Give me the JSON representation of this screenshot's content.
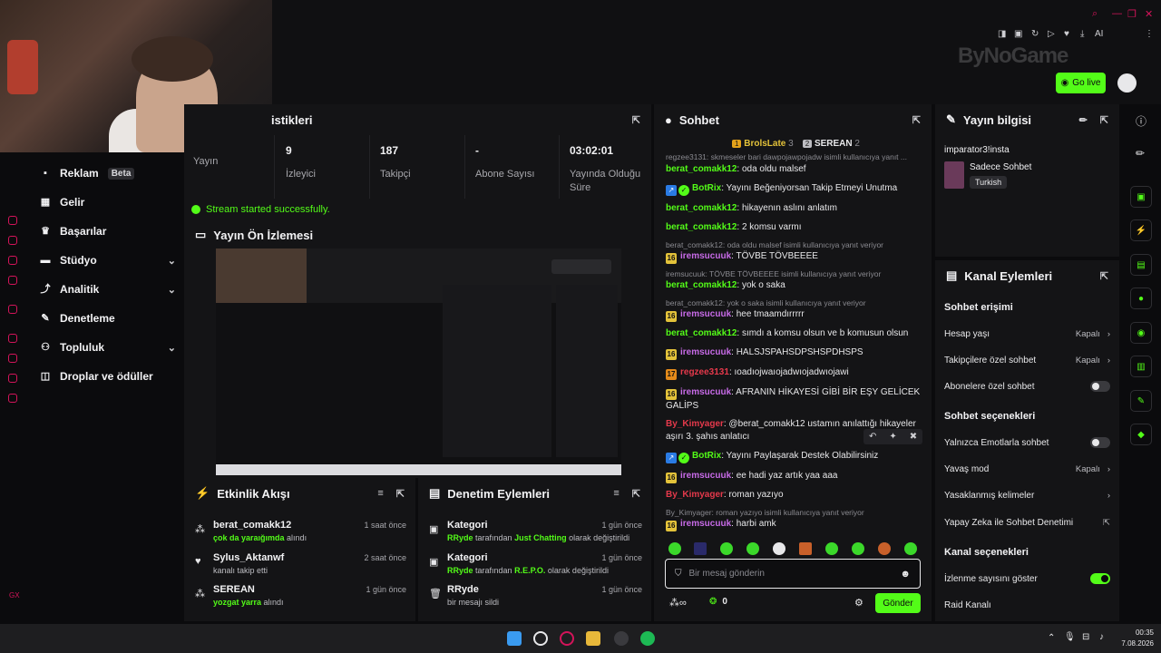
{
  "header": {
    "logo_text": "ByNoGame",
    "go_live_label": "Go live",
    "window_controls": [
      "search-icon",
      "minimize-icon",
      "maximize-icon",
      "close-icon"
    ],
    "extensions_label": "AI"
  },
  "sidebar": {
    "items": [
      {
        "label": "Reklam",
        "badge": "Beta",
        "icon": "megaphone-icon"
      },
      {
        "label": "Gelir",
        "icon": "chart-icon"
      },
      {
        "label": "Başarılar",
        "icon": "trophy-icon"
      },
      {
        "label": "Stüdyo",
        "icon": "studio-icon",
        "expandable": true
      },
      {
        "label": "Analitik",
        "icon": "analytics-icon",
        "expandable": true
      },
      {
        "label": "Denetleme",
        "icon": "wrench-icon"
      },
      {
        "label": "Topluluk",
        "icon": "people-icon",
        "expandable": true
      },
      {
        "label": "Droplar ve ödüller",
        "icon": "gift-icon"
      }
    ],
    "footer": "GX"
  },
  "stats": {
    "title": "istikleri",
    "items": [
      {
        "value": "",
        "label": "Yayın"
      },
      {
        "value": "9",
        "label": "İzleyici"
      },
      {
        "value": "187",
        "label": "Takipçi"
      },
      {
        "value": "-",
        "label": "Abone Sayısı"
      },
      {
        "value": "03:02:01",
        "label": "Yayında Olduğu Süre"
      }
    ],
    "status": "Stream started successfully."
  },
  "preview": {
    "title": "Yayın Ön İzlemesi"
  },
  "activity": {
    "title": "Etkinlik Akışı",
    "items": [
      {
        "user": "berat_comakk12",
        "time": "1 saat önce",
        "detail_hl": "çok da yaraığımda",
        "detail": " alındı",
        "icon": "reward-icon"
      },
      {
        "user": "Sylus_Aktanwf",
        "time": "2 saat önce",
        "detail_hl": "",
        "detail": "kanalı takip etti",
        "icon": "heart-icon"
      },
      {
        "user": "SEREAN",
        "time": "1 gün önce",
        "detail_hl": "yozgat yarra",
        "detail": " alındı",
        "icon": "reward-icon"
      }
    ]
  },
  "mod_actions": {
    "title": "Denetim Eylemleri",
    "items": [
      {
        "title": "Kategori",
        "time": "1 gün önce",
        "by": "RRyde",
        "mid": " tarafından ",
        "hl": "Just Chatting",
        "tail": " olarak değiştirildi",
        "icon": "category-icon"
      },
      {
        "title": "Kategori",
        "time": "1 gün önce",
        "by": "RRyde",
        "mid": " tarafından ",
        "hl": "R.E.P.O.",
        "tail": " olarak değiştirildi",
        "icon": "category-icon"
      },
      {
        "title": "RRyde",
        "time": "1 gün önce",
        "by": "",
        "mid": "",
        "hl": "",
        "tail": "bir mesajı sildi",
        "icon": "trash-icon"
      }
    ]
  },
  "chat": {
    "title": "Sohbet",
    "top_gifters": [
      {
        "name": "BrolsLate",
        "count": "3",
        "rank": "1"
      },
      {
        "name": "SEREAN",
        "count": "2",
        "rank": "2"
      }
    ],
    "messages": [
      {
        "kind": "reply",
        "text": "regzee3131: skmeseler bari dawpojawpojadw isimli kullanıcıya yanıt ..."
      },
      {
        "kind": "msg",
        "user": "berat_comakk12",
        "color": "#53fc18",
        "text": ": oda oldu malsef"
      },
      {
        "kind": "msg",
        "user": "BotRix",
        "color": "#53fc18",
        "bot": true,
        "text": ": Yayını Beğeniyorsan Takip Etmeyi Unutma"
      },
      {
        "kind": "msg",
        "user": "berat_comakk12",
        "color": "#53fc18",
        "text": ": hikayenın aslını anlatım"
      },
      {
        "kind": "msg",
        "user": "berat_comakk12",
        "color": "#53fc18",
        "text": ": 2 komsu varmı"
      },
      {
        "kind": "reply",
        "text": "berat_comakk12: oda oldu malsef isimli kullanıcıya yanıt veriyor"
      },
      {
        "kind": "msg",
        "user": "iremsucuuk",
        "color": "#c86be8",
        "sub": "16",
        "text": ": TÖVBE TÖVBEEEE"
      },
      {
        "kind": "reply",
        "text": "iremsucuuk: TÖVBE TÖVBEEEE isimli kullanıcıya yanıt veriyor"
      },
      {
        "kind": "msg",
        "user": "berat_comakk12",
        "color": "#53fc18",
        "text": ": yok o saka"
      },
      {
        "kind": "reply",
        "text": "berat_comakk12: yok o saka isimli kullanıcıya yanıt veriyor"
      },
      {
        "kind": "msg",
        "user": "iremsucuuk",
        "color": "#c86be8",
        "sub": "16",
        "text": ": hee tmaamdırrrrr"
      },
      {
        "kind": "msg",
        "user": "berat_comakk12",
        "color": "#53fc18",
        "text": ": sımdı a komsu olsun ve b komusun olsun"
      },
      {
        "kind": "msg",
        "user": "iremsucuuk",
        "color": "#c86be8",
        "sub": "16",
        "text": ": HALSJSPAHSDPSHSPDHSPS"
      },
      {
        "kind": "msg",
        "user": "regzee3131",
        "color": "#e5394b",
        "sub": "17",
        "text": ": ıoadıojwaıojadwıojadwıojawi"
      },
      {
        "kind": "msg",
        "user": "iremsucuuk",
        "color": "#c86be8",
        "sub": "16",
        "text": ": AFRANIN HİKAYESİ GİBİ BİR EŞY GELİCEK GALİPS"
      },
      {
        "kind": "msg",
        "user": "By_Kimyager",
        "color": "#e5394b",
        "text": ": @berat_comakk12 ustamın anılattığı hikayeler aşırı 3. şahıs anlatıcı"
      },
      {
        "kind": "msg",
        "user": "BotRix",
        "color": "#53fc18",
        "bot": true,
        "text": ": Yayını Paylaşarak Destek Olabilirsiniz"
      },
      {
        "kind": "msg",
        "user": "iremsucuuk",
        "color": "#c86be8",
        "sub": "16",
        "text": ": ee hadi yaz artık yaa aaa"
      },
      {
        "kind": "msg",
        "user": "By_Kimyager",
        "color": "#e5394b",
        "text": ": roman yazıyo"
      },
      {
        "kind": "reply",
        "text": "By_Kimyager: roman yazıyo isimli kullanıcıya yanıt veriyor"
      },
      {
        "kind": "msg",
        "user": "iremsucuuk",
        "color": "#c86be8",
        "sub": "16",
        "text": ": harbi amk"
      }
    ],
    "input_placeholder": "Bir mesaj gönderin",
    "points": "0",
    "send_label": "Gönder"
  },
  "stream_info": {
    "title": "Yayın bilgisi",
    "stream_title": "imparator3!insta",
    "category": "Sadece Sohbet",
    "tag": "Turkish"
  },
  "channel_actions": {
    "title": "Kanal Eylemleri",
    "chat_access_title": "Sohbet erişimi",
    "chat_options_title": "Sohbet seçenekleri",
    "channel_options_title": "Kanal seçenekleri",
    "off_label": "Kapalı",
    "rows": {
      "account_age": "Hesap yaşı",
      "followers_only": "Takipçilere özel sohbet",
      "subs_only": "Abonelere özel sohbet",
      "emote_only": "Yalnızca Emotlarla sohbet",
      "slow_mode": "Yavaş mod",
      "banned_words": "Yasaklanmış kelimeler",
      "ai_moderation": "Yapay Zeka ile Sohbet Denetimi",
      "show_viewers": "İzlenme sayısını göster",
      "raid": "Raid Kanalı"
    },
    "toggles": {
      "subs_only": false,
      "emote_only": false,
      "show_viewers": true
    }
  },
  "taskbar": {
    "time": "00:35",
    "date": "7.08.2026"
  },
  "colors": {
    "accent": "#53fc18",
    "danger": "#d4145a",
    "panel": "#141416"
  }
}
